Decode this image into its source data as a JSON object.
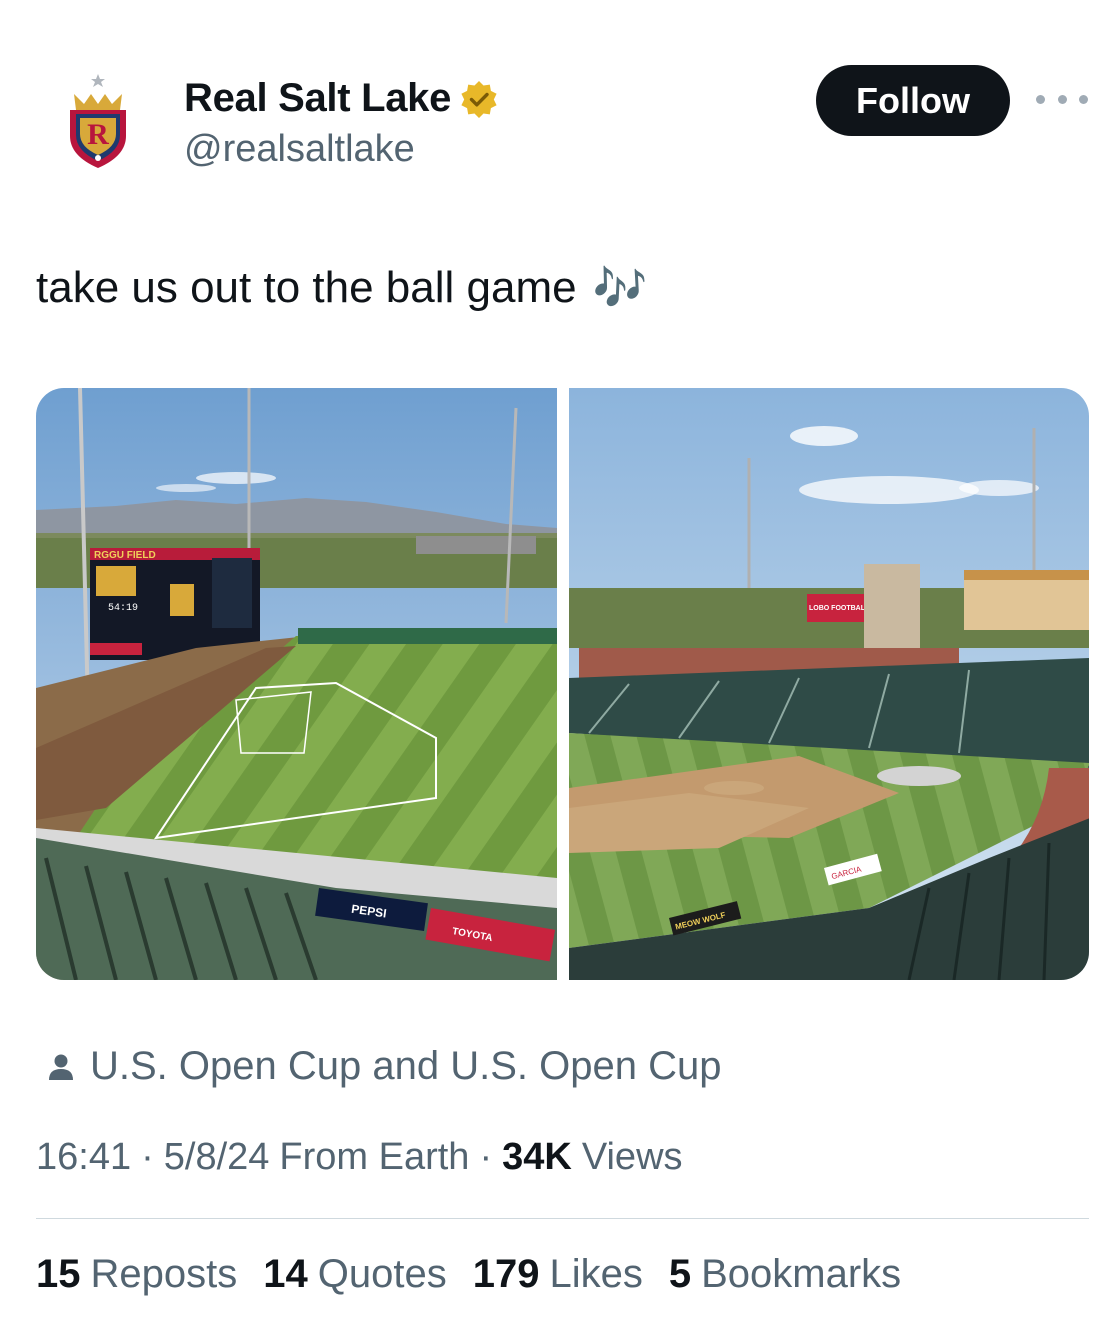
{
  "author": {
    "display_name": "Real Salt Lake",
    "handle": "@realsaltlake",
    "avatar_icon": "rsl-crest-icon",
    "verified_icon": "verified-gold-badge-icon"
  },
  "actions": {
    "follow_label": "Follow",
    "more_icon": "more-dots-icon"
  },
  "tweet": {
    "text": "take us out to the ball game",
    "emoji": "🎶"
  },
  "media": {
    "photos": [
      {
        "name": "stadium-photo-left",
        "scoreboard_text": "54:19",
        "board_banner": "RGGU FIELD",
        "ad_pepsi": "PEPSI",
        "ad_toyota": "TOYOTA"
      },
      {
        "name": "stadium-photo-right",
        "banner_text": "LOBO FOOTBALL",
        "ad_garcia": "GARCIA",
        "ad_meow": "MEOW WOLF"
      }
    ]
  },
  "tagged": {
    "icon": "person-icon",
    "text": "U.S. Open Cup and U.S. Open Cup"
  },
  "meta": {
    "time": "16:41",
    "date": "5/8/24",
    "source": "From Earth",
    "views_count": "34K",
    "views_label": "Views",
    "separator": "·"
  },
  "stats": [
    {
      "count": "15",
      "label": "Reposts"
    },
    {
      "count": "14",
      "label": "Quotes"
    },
    {
      "count": "179",
      "label": "Likes"
    },
    {
      "count": "5",
      "label": "Bookmarks"
    }
  ],
  "colors": {
    "text_primary": "#0f1419",
    "text_secondary": "#536471",
    "verified_gold": "#e8b829",
    "follow_bg": "#0f1419",
    "divider": "#cfd9de"
  }
}
